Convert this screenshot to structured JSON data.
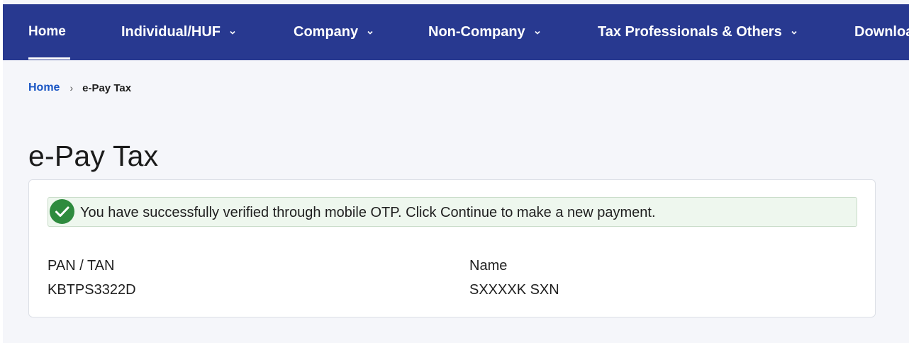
{
  "nav": {
    "items": [
      {
        "label": "Home",
        "active": true
      },
      {
        "label": "Individual/HUF",
        "dropdown": true
      },
      {
        "label": "Company",
        "dropdown": true
      },
      {
        "label": "Non-Company",
        "dropdown": true
      },
      {
        "label": "Tax Professionals & Others",
        "dropdown": true
      },
      {
        "label": "Downloa"
      }
    ]
  },
  "breadcrumb": {
    "home": "Home",
    "separator": "›",
    "current": "e-Pay Tax"
  },
  "page": {
    "title": "e-Pay Tax"
  },
  "alert": {
    "icon": "check-circle-icon",
    "message": "You have successfully verified through mobile OTP. Click Continue to make a new payment."
  },
  "details": {
    "pan_label": "PAN / TAN",
    "pan_value": "KBTPS3322D",
    "name_label": "Name",
    "name_value": "SXXXXK SXN"
  },
  "colors": {
    "nav_bg": "#283990",
    "link": "#1a56c4",
    "success": "#2e8b3e",
    "alert_bg": "#eef7ee"
  }
}
